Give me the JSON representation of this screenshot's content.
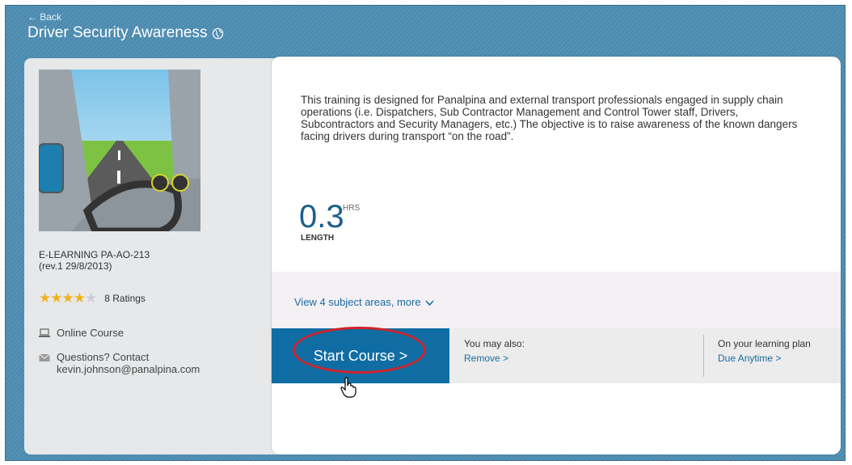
{
  "header": {
    "back_label": "← Back",
    "title": "Driver Security Awareness"
  },
  "sidebar": {
    "course_code": "E-LEARNING PA-AO-213",
    "revision": "(rev.1 29/8/2013)",
    "stars_filled": 4,
    "stars_total": 5,
    "ratings_label": "8 Ratings",
    "course_type": "Online Course",
    "contact_label": "Questions? Contact",
    "contact_email": "kevin.johnson@panalpina.com"
  },
  "main": {
    "description": "This training is designed for Panalpina and external transport professionals engaged in supply chain operations (i.e. Dispatchers, Sub Contractor Management and Control Tower staff, Drivers, Subcontractors and Security Managers, etc.) The objective is to raise awareness of the known dangers facing drivers during transport “on the road”.",
    "length_value": "0.3",
    "length_unit": "HRS",
    "length_label": "LENGTH",
    "subject_link": "View 4 subject areas, more"
  },
  "actions": {
    "start_label": "Start Course >",
    "also_label": "You may also:",
    "remove_link": "Remove >",
    "plan_label": "On your learning plan",
    "due_link": "Due Anytime >"
  },
  "colors": {
    "brand_blue": "#0f6da3",
    "highlight_red": "#d0232a",
    "star_gold": "#f3b21a"
  }
}
